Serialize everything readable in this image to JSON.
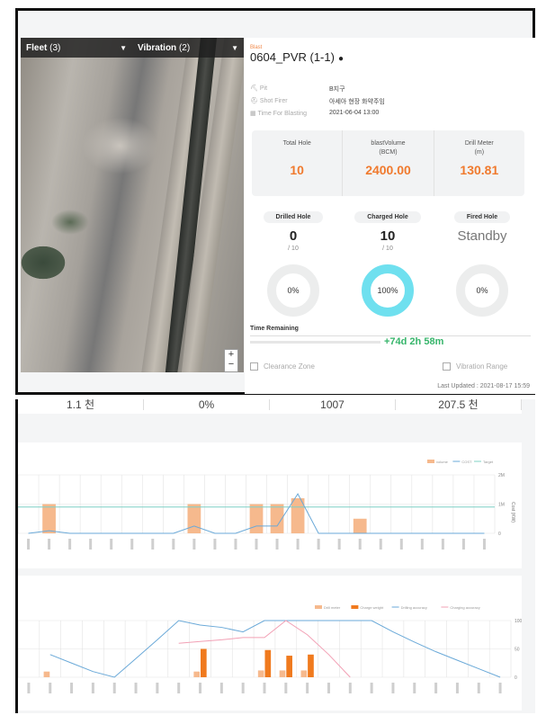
{
  "map": {
    "fleet_label": "Fleet",
    "fleet_count": "(3)",
    "vibration_label": "Vibration",
    "vibration_count": "(2)",
    "zoom_in": "+",
    "zoom_out": "−"
  },
  "blast": {
    "label": "Blast",
    "title": "0604_PVR (1-1)",
    "fields": [
      {
        "key": "Pit",
        "value": "B지구"
      },
      {
        "key": "Shot Firer",
        "value": "아세아 현장 화약주임"
      },
      {
        "key": "Time For Blasting",
        "value": "2021-06-04 13:00"
      }
    ],
    "summary": [
      {
        "label": "Total Hole",
        "unit": "",
        "value": "10"
      },
      {
        "label": "blastVolume",
        "unit": "(BCM)",
        "value": "2400.00"
      },
      {
        "label": "Drill Meter",
        "unit": "(m)",
        "value": "130.81"
      }
    ],
    "stats": [
      {
        "label": "Drilled Hole",
        "value": "0",
        "sub": "/ 10",
        "pct": "0%"
      },
      {
        "label": "Charged Hole",
        "value": "10",
        "sub": "/ 10",
        "pct": "100%"
      },
      {
        "label": "Fired Hole",
        "value": "Standby",
        "sub": "",
        "pct": "0%"
      }
    ],
    "time_remaining_label": "Time Remaining",
    "time_remaining_value": "+74d 2h 58m",
    "clearance_label": "Clearance Zone",
    "vibration_range_label": "Vibration Range",
    "last_updated": "Last Updated : 2021-08-17 15:59"
  },
  "strip": [
    "1.1 천",
    "0%",
    "1007",
    "207.5 천"
  ],
  "colors": {
    "accent": "#f07a2e",
    "green": "#37b56b",
    "cyan": "#6fe0ef",
    "bar_light": "#f6b98d",
    "bar_dark": "#f07a1e"
  },
  "chart_data": [
    {
      "type": "bar",
      "legend": [
        "volume",
        "COST",
        "Target"
      ],
      "ylabel": "Cost (KW)",
      "yticks": [
        "2M",
        "1M",
        "0"
      ],
      "ylim": [
        0,
        2000000
      ],
      "target": 900000,
      "bars": [
        0,
        1000000,
        0,
        0,
        0,
        0,
        0,
        0,
        1000000,
        0,
        0,
        1000000,
        1000000,
        1200000,
        0,
        0,
        500000,
        0,
        0,
        0,
        0,
        0,
        0
      ],
      "cost": [
        0,
        90000,
        0,
        0,
        0,
        0,
        0,
        0,
        250000,
        0,
        0,
        250000,
        250000,
        1350000,
        0,
        0,
        0,
        0,
        0,
        0,
        0,
        0,
        0
      ]
    },
    {
      "type": "bar",
      "legend": [
        "Drill meter",
        "Charge weight",
        "Drilling accuracy",
        "Charging accuracy"
      ],
      "yticks": [
        "100",
        "50",
        "0"
      ],
      "ylim": [
        0,
        100
      ],
      "drill": [
        0,
        10,
        0,
        0,
        0,
        0,
        0,
        0,
        10,
        0,
        0,
        12,
        12,
        12,
        0,
        0,
        0,
        0,
        0,
        0,
        0,
        0,
        0
      ],
      "charge": [
        0,
        0,
        0,
        0,
        0,
        0,
        0,
        0,
        50,
        0,
        0,
        48,
        38,
        40,
        0,
        0,
        0,
        0,
        0,
        0,
        0,
        0,
        0
      ],
      "drilling_accuracy": [
        null,
        40,
        25,
        10,
        0,
        33,
        66,
        100,
        92,
        88,
        80,
        100,
        100,
        100,
        100,
        100,
        100,
        80,
        62,
        45,
        30,
        15,
        0
      ],
      "charging_accuracy": [
        null,
        null,
        null,
        null,
        null,
        null,
        null,
        60,
        63,
        66,
        70,
        70,
        100,
        75,
        40,
        0,
        null,
        null,
        null,
        null,
        null,
        null,
        null
      ]
    }
  ]
}
